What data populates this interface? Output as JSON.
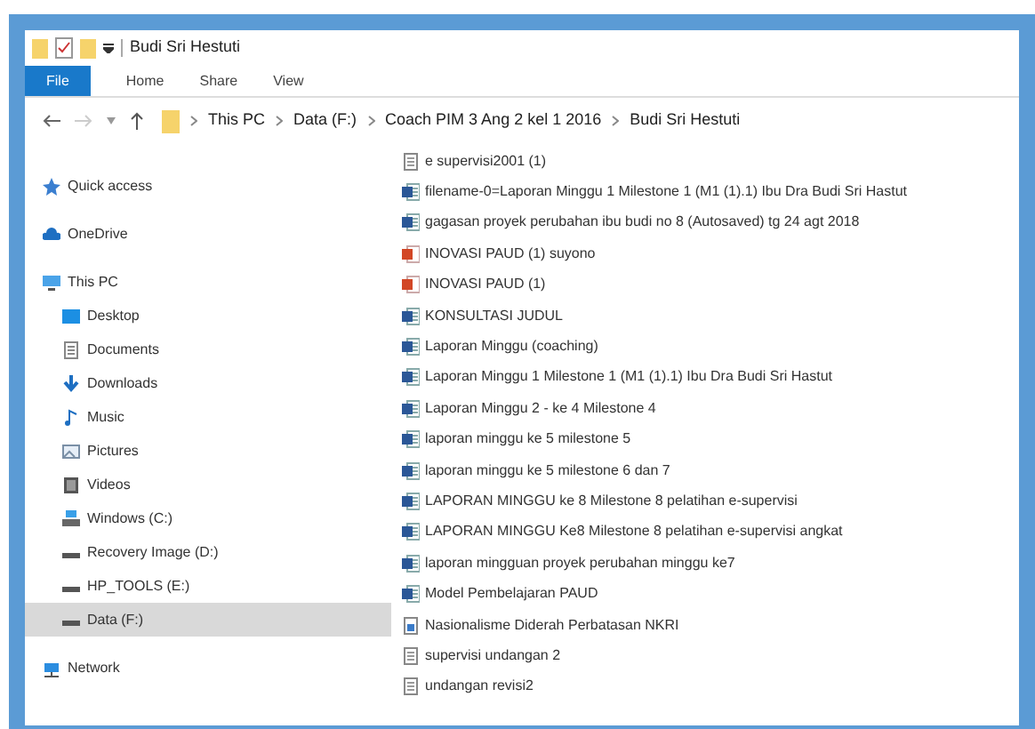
{
  "window": {
    "title": "Budi Sri Hestuti"
  },
  "ribbon_tabs": [
    {
      "label": "File",
      "selected": true
    },
    {
      "label": "Home",
      "selected": false
    },
    {
      "label": "Share",
      "selected": false
    },
    {
      "label": "View",
      "selected": false
    }
  ],
  "breadcrumb": [
    "This PC",
    "Data (F:)",
    "Coach PIM 3 Ang 2 kel 1 2016",
    "Budi Sri Hestuti"
  ],
  "sidebar": {
    "items": [
      {
        "label": "Quick access",
        "kind": "star",
        "selected": false
      },
      {
        "label": "OneDrive",
        "kind": "cloud",
        "selected": false
      },
      {
        "label": "This PC",
        "kind": "pc",
        "selected": false,
        "children": [
          {
            "label": "Desktop",
            "kind": "desktop",
            "selected": false
          },
          {
            "label": "Documents",
            "kind": "doc",
            "selected": false
          },
          {
            "label": "Downloads",
            "kind": "down",
            "selected": false
          },
          {
            "label": "Music",
            "kind": "music",
            "selected": false
          },
          {
            "label": "Pictures",
            "kind": "pictures",
            "selected": false
          },
          {
            "label": "Videos",
            "kind": "videos",
            "selected": false
          },
          {
            "label": "Windows (C:)",
            "kind": "windrive",
            "selected": false
          },
          {
            "label": "Recovery Image (D:)",
            "kind": "drive",
            "selected": false
          },
          {
            "label": "HP_TOOLS (E:)",
            "kind": "drive",
            "selected": false
          },
          {
            "label": "Data (F:)",
            "kind": "drive",
            "selected": true
          }
        ]
      },
      {
        "label": "Network",
        "kind": "network",
        "selected": false
      }
    ]
  },
  "files": [
    {
      "name": "e supervisi2001 (1)",
      "kind": "page"
    },
    {
      "name": "filename-0=Laporan Minggu 1 Milestone 1 (M1 (1).1) Ibu Dra Budi Sri  Hastut",
      "kind": "word"
    },
    {
      "name": "gagasan proyek perubahan ibu budi no 8 (Autosaved) tg 24  agt 2018",
      "kind": "word"
    },
    {
      "name": "INOVASI PAUD (1) suyono",
      "kind": "red"
    },
    {
      "name": "INOVASI PAUD (1)",
      "kind": "red"
    },
    {
      "name": "KONSULTASI JUDUL",
      "kind": "word"
    },
    {
      "name": "Laporan Minggu (coaching)",
      "kind": "word"
    },
    {
      "name": "Laporan Minggu 1 Milestone 1 (M1 (1).1) Ibu Dra Budi Sri  Hastut",
      "kind": "word"
    },
    {
      "name": "Laporan Minggu 2 - ke 4 Milestone 4",
      "kind": "word"
    },
    {
      "name": "laporan minggu ke 5 milestone 5",
      "kind": "word"
    },
    {
      "name": "laporan minggu ke 5 milestone 6 dan 7",
      "kind": "word"
    },
    {
      "name": "LAPORAN MINGGU ke 8 Milestone 8 pelatihan  e-supervisi",
      "kind": "word"
    },
    {
      "name": "LAPORAN MINGGU Ke8 Milestone 8 pelatihan e-supervisi  angkat",
      "kind": "word"
    },
    {
      "name": "laporan mingguan proyek perubahan  minggu ke7",
      "kind": "word"
    },
    {
      "name": "Model Pembelajaran PAUD",
      "kind": "word"
    },
    {
      "name": "Nasionalisme Diderah Perbatasan NKRI",
      "kind": "image"
    },
    {
      "name": "supervisi undangan 2",
      "kind": "page"
    },
    {
      "name": "undangan revisi2",
      "kind": "page"
    }
  ]
}
